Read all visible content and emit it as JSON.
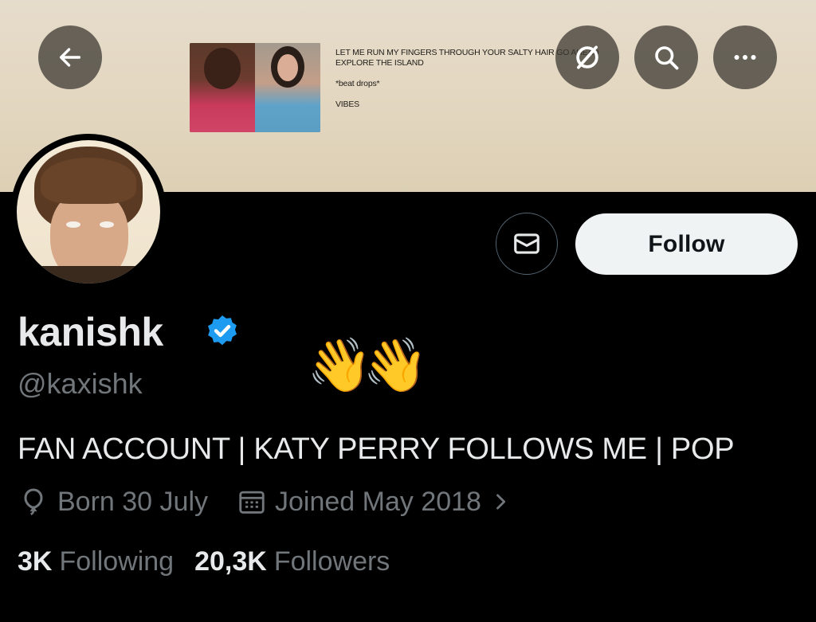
{
  "banner": {
    "caption_line1": "LET ME RUN MY FINGERS THROUGH YOUR SALTY HAIR GO AHEAD",
    "caption_line2": "EXPLORE THE ISLAND",
    "caption_line3": "*beat drops*",
    "caption_line4": "VIBES"
  },
  "topbar": {
    "back_icon": "arrow-left-icon",
    "translate_icon": "no-translate-icon",
    "search_icon": "search-icon",
    "more_icon": "more-horizontal-icon"
  },
  "profile": {
    "display_name": "kanishk",
    "handle": "@kaxishk",
    "emoji": "👋👋",
    "bio": "FAN ACCOUNT | KATY PERRY FOLLOWS ME | POP",
    "birthday": "Born 30 July",
    "joined": "Joined May 2018",
    "following_count": "3K",
    "following_label": "Following",
    "followers_count": "20,3K",
    "followers_label": "Followers"
  },
  "actions": {
    "follow_label": "Follow",
    "message_icon": "envelope-icon"
  },
  "colors": {
    "verified": "#1d9bf0",
    "muted": "#71767b",
    "follow_bg": "#eff3f4"
  }
}
